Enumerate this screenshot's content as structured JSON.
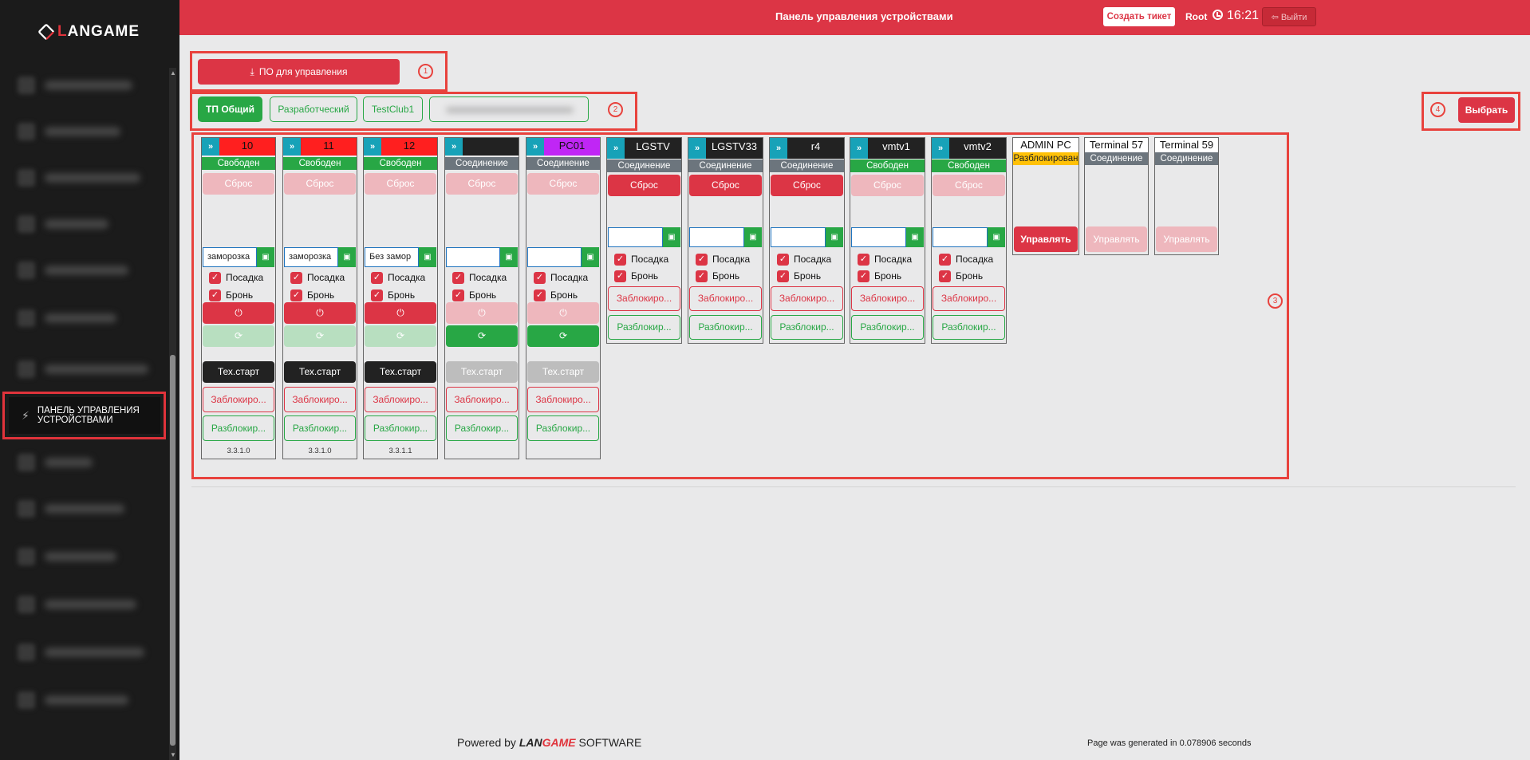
{
  "sidebar": {
    "logo_text_a": "L",
    "logo_text_b": "ANGAME",
    "active_item_label": "ПАНЕЛЬ УПРАВЛЕНИЯ УСТРОЙСТВАМИ"
  },
  "topbar": {
    "title": "Панель управления устройствами",
    "create_ticket": "Создать тикет",
    "user": "Root",
    "time": "16:21",
    "logout": "Выйти"
  },
  "annotations": [
    "1",
    "2",
    "3",
    "4"
  ],
  "download_button": "ПО для управления",
  "tabs": [
    {
      "label": "ТП Общий",
      "active": true
    },
    {
      "label": "Разработческий",
      "active": false
    },
    {
      "label": "TestClub1",
      "active": false
    }
  ],
  "choose_button": "Выбрать",
  "labels": {
    "reset": "Сброс",
    "seat": "Посадка",
    "booking": "Бронь",
    "tech_start": "Тех.старт",
    "lock": "Заблокиро...",
    "unlock": "Разблокир...",
    "manage": "Управлять",
    "power_icon": "⏻",
    "sync_icon": "⟳",
    "save_icon": "▣",
    "chevron": "»"
  },
  "devices": [
    {
      "name": "10",
      "status": "Свободен",
      "field": "заморозка",
      "version": "3.3.1.0",
      "head_color": "#ff1f1f"
    },
    {
      "name": "11",
      "status": "Свободен",
      "field": "заморозка",
      "version": "3.3.1.0",
      "head_color": "#ff1f1f"
    },
    {
      "name": "12",
      "status": "Свободен",
      "field": "Без замор",
      "version": "3.3.1.1",
      "head_color": "#ff1f1f"
    },
    {
      "name": "",
      "status": "Соединение",
      "field": "",
      "version": "",
      "head_color": "#222222"
    },
    {
      "name": "PC01",
      "status": "Соединение",
      "field": "",
      "version": "",
      "head_color": "#c026f5"
    }
  ],
  "tvs": [
    {
      "name": "LGSTV",
      "status": "Соединение"
    },
    {
      "name": "LGSTV33",
      "status": "Соединение"
    },
    {
      "name": "r4",
      "status": "Соединение"
    },
    {
      "name": "vmtv1",
      "status": "Свободен"
    },
    {
      "name": "vmtv2",
      "status": "Свободен"
    }
  ],
  "terminals": [
    {
      "name": "ADMIN PC",
      "status": "Разблокирован"
    },
    {
      "name": "Terminal 57",
      "status": "Соединение"
    },
    {
      "name": "Terminal 59",
      "status": "Соединение"
    }
  ],
  "footer": {
    "powered_by": "Powered by",
    "brand_a": "LAN",
    "brand_b": "GAME",
    "software": "SOFTWARE",
    "generated": "Page was generated in 0.078906 seconds"
  }
}
